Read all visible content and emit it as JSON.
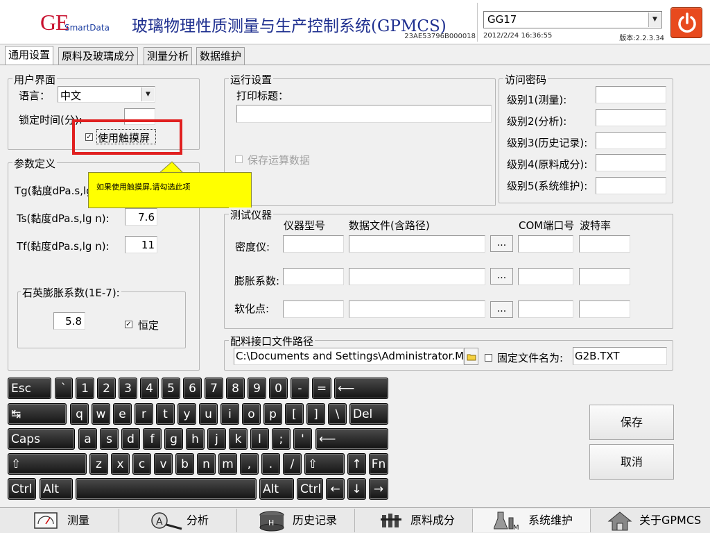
{
  "header": {
    "logo_ge": "GE",
    "logo_smartdata": "SmartData",
    "title": "玻璃物理性质测量与生产控制系统(GPMCS)",
    "serial": "23AE53796B000018",
    "product_select": "GG17",
    "datetime": "2012/2/24 16:36:55",
    "version": "版本:2.2.3.34",
    "power_color": "#e84a1e"
  },
  "tabs": [
    "通用设置",
    "原料及玻璃成分",
    "测量分析",
    "数据维护"
  ],
  "user_interface": {
    "title": "用户界面",
    "language_label": "语言：",
    "language_value": "中文",
    "lock_time_label": "锁定时间(分):",
    "lock_time_value": "",
    "touchscreen_label": "使用触摸屏",
    "touchscreen_checked": true,
    "highlight_color": "#e02020"
  },
  "tooltip": {
    "text": "如果使用触摸屏,请勾选此项",
    "color": "#ffff00"
  },
  "params": {
    "title": "参数定义",
    "tg_label": "Tg(黏度dPa.s,lg n):",
    "ts_label": "Ts(黏度dPa.s,lg n):",
    "ts_value": "7.6",
    "tf_label": "Tf(黏度dPa.s,lg n):",
    "tf_value": "11",
    "quartz_title": "石英膨胀系数(1E-7):",
    "quartz_value": "5.8",
    "constant_label": "恒定",
    "constant_checked": true
  },
  "run_settings": {
    "title": "运行设置",
    "print_title_label": "打印标题：",
    "print_title_value": "",
    "save_data_label": "保存运算数据"
  },
  "passwords": {
    "title": "访问密码",
    "levels": [
      "级别1(测量):",
      "级别2(分析):",
      "级别3(历史记录):",
      "级别4(原料成分):",
      "级别5(系统维护):"
    ]
  },
  "instruments": {
    "title": "测试仪器",
    "col_model": "仪器型号",
    "col_file": "数据文件(含路径)",
    "col_com": "COM端口号",
    "col_baud": "波特率",
    "rows": [
      "密度仪:",
      "膨胀系数:",
      "软化点:"
    ],
    "browse_label": "..."
  },
  "ingredient_path": {
    "title": "配料接口文件路径",
    "path_value": "C:\\Documents and Settings\\Administrator.MIC",
    "fixed_name_label": "固定文件名为:",
    "fixed_name_checked": false,
    "file_name_value": "G2B.TXT"
  },
  "keyboard": {
    "row1": [
      "Esc",
      "`",
      "1",
      "2",
      "3",
      "4",
      "5",
      "6",
      "7",
      "8",
      "9",
      "0",
      "-",
      "=",
      "⟵"
    ],
    "row2": [
      "↹",
      "q",
      "w",
      "e",
      "r",
      "t",
      "y",
      "u",
      "i",
      "o",
      "p",
      "[",
      "]",
      "\\",
      "Del"
    ],
    "row3": [
      "Caps",
      "a",
      "s",
      "d",
      "f",
      "g",
      "h",
      "j",
      "k",
      "l",
      ";",
      "'",
      "⟵"
    ],
    "row4": [
      "⇧",
      "z",
      "x",
      "c",
      "v",
      "b",
      "n",
      "m",
      ",",
      ".",
      "/",
      "⇧",
      "↑",
      "Fn"
    ],
    "row5": [
      "Ctrl",
      "Alt",
      "",
      "Alt",
      "Ctrl",
      "←",
      "↓",
      "→"
    ]
  },
  "actions": {
    "save": "保存",
    "cancel": "取消"
  },
  "bottom_nav": [
    {
      "label": "测量",
      "icon": "gauge-icon"
    },
    {
      "label": "分析",
      "icon": "magnifier-icon"
    },
    {
      "label": "历史记录",
      "icon": "database-icon"
    },
    {
      "label": "原料成分",
      "icon": "material-icon"
    },
    {
      "label": "系统维护",
      "icon": "flask-icon"
    },
    {
      "label": "关于GPMCS",
      "icon": "home-icon"
    }
  ]
}
